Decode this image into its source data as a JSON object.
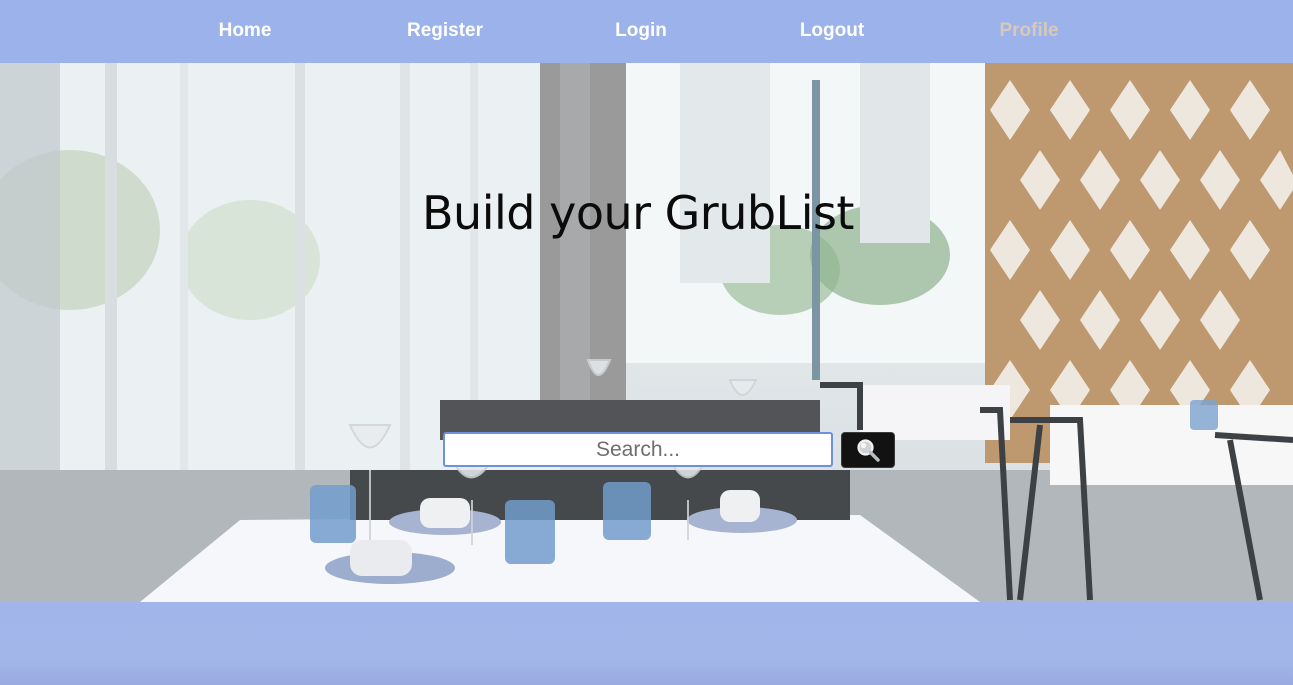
{
  "nav": {
    "links": [
      {
        "label": "Home"
      },
      {
        "label": "Register"
      },
      {
        "label": "Login"
      },
      {
        "label": "Logout"
      },
      {
        "label": "Profile"
      }
    ]
  },
  "hero": {
    "headline": "Build your GrubList"
  },
  "search": {
    "placeholder": "Search...",
    "value": "",
    "button_icon": "magnifier-icon"
  },
  "colors": {
    "nav_bar": "#84a0e8",
    "search_border": "#6f8fe0",
    "search_button": "#121212",
    "footer_band": "#a3b6ea",
    "headline_text": "#0b0b0b"
  }
}
